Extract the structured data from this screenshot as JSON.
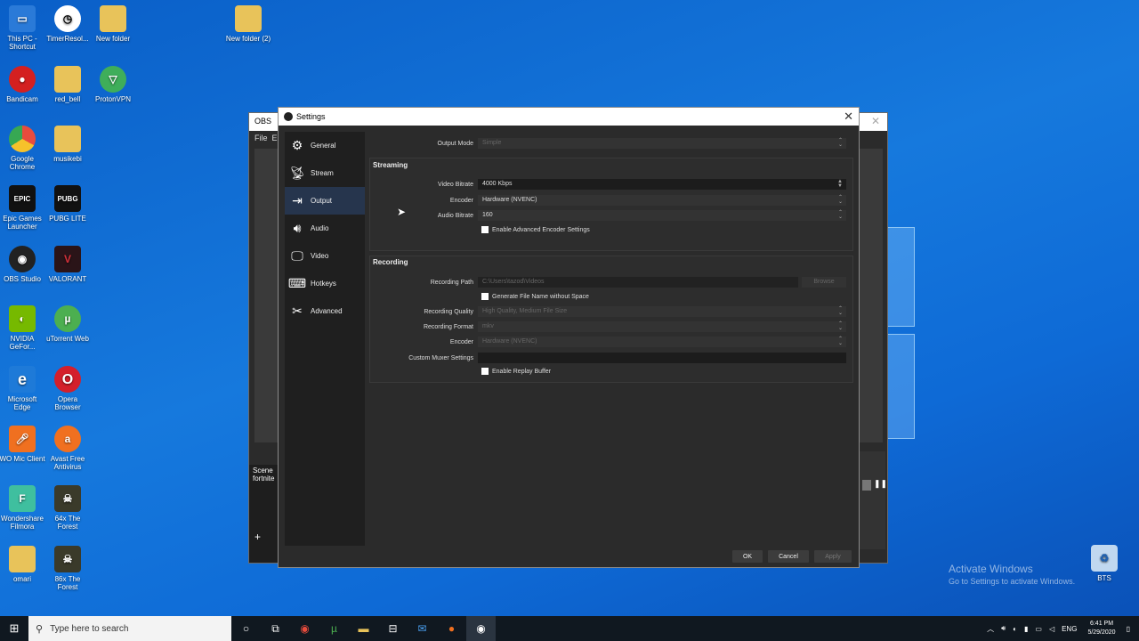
{
  "desktop": {
    "icons": [
      {
        "label": "This PC - Shortcut",
        "color": "#2a7ad8"
      },
      {
        "label": "TimerResol...",
        "color": "#ffffff"
      },
      {
        "label": "New folder",
        "color": "#e8c35a"
      },
      {
        "label": "New folder (2)",
        "color": "#e8c35a"
      },
      {
        "label": "Bandicam",
        "color": "#d42020"
      },
      {
        "label": "red_bell",
        "color": "#e8c35a"
      },
      {
        "label": "ProtonVPN",
        "color": "#3fae5a"
      },
      {
        "label": "Google Chrome",
        "color": "#e84c3d"
      },
      {
        "label": "musikebi",
        "color": "#e8c35a"
      },
      {
        "label": "Epic Games Launcher",
        "color": "#111111"
      },
      {
        "label": "PUBG LITE",
        "color": "#111111"
      },
      {
        "label": "OBS Studio",
        "color": "#222222"
      },
      {
        "label": "VALORANT",
        "color": "#d4303a"
      },
      {
        "label": "NVIDIA GeFor...",
        "color": "#76b900"
      },
      {
        "label": "uTorrent Web",
        "color": "#4caf50"
      },
      {
        "label": "Microsoft Edge",
        "color": "#1e7ad8"
      },
      {
        "label": "Opera Browser",
        "color": "#d41f2b"
      },
      {
        "label": "WO Mic Client",
        "color": "#f07020"
      },
      {
        "label": "Avast Free Antivirus",
        "color": "#f07020"
      },
      {
        "label": "Wondershare Filmora",
        "color": "#3fbf9f"
      },
      {
        "label": "64x The Forest",
        "color": "#3a3a2a"
      },
      {
        "label": "omari",
        "color": "#e8c35a"
      },
      {
        "label": "86x The Forest",
        "color": "#3a3a2a"
      },
      {
        "label": "BTS",
        "color": "#c0d8f0"
      }
    ]
  },
  "obs_main": {
    "title": "OBS",
    "menu_file": "File",
    "menu_edit": "E",
    "scenes_header": "Scene",
    "scene_item": "fortnite"
  },
  "settings": {
    "title": "Settings",
    "sidebar": [
      {
        "label": "General",
        "icon": "gear-icon"
      },
      {
        "label": "Stream",
        "icon": "antenna-icon"
      },
      {
        "label": "Output",
        "icon": "output-icon"
      },
      {
        "label": "Audio",
        "icon": "speaker-icon"
      },
      {
        "label": "Video",
        "icon": "monitor-icon"
      },
      {
        "label": "Hotkeys",
        "icon": "keyboard-icon"
      },
      {
        "label": "Advanced",
        "icon": "tools-icon"
      }
    ],
    "active_item": "Output",
    "output_mode_label": "Output Mode",
    "output_mode_value": "Simple",
    "streaming": {
      "title": "Streaming",
      "video_bitrate_label": "Video Bitrate",
      "video_bitrate_value": "4000 Kbps",
      "encoder_label": "Encoder",
      "encoder_value": "Hardware (NVENC)",
      "audio_bitrate_label": "Audio Bitrate",
      "audio_bitrate_value": "160",
      "advanced_encoder_label": "Enable Advanced Encoder Settings"
    },
    "recording": {
      "title": "Recording",
      "path_label": "Recording Path",
      "path_value": "C:\\Users\\tazod\\Videos",
      "browse_label": "Browse",
      "no_space_label": "Generate File Name without Space",
      "quality_label": "Recording Quality",
      "quality_value": "High Quality, Medium File Size",
      "format_label": "Recording Format",
      "format_value": "mkv",
      "encoder_label": "Encoder",
      "encoder_value": "Hardware (NVENC)",
      "muxer_label": "Custom Muxer Settings",
      "muxer_value": "",
      "replay_label": "Enable Replay Buffer"
    },
    "buttons": {
      "ok": "OK",
      "cancel": "Cancel",
      "apply": "Apply"
    }
  },
  "watermark": {
    "line1": "Activate Windows",
    "line2": "Go to Settings to activate Windows."
  },
  "taskbar": {
    "search_placeholder": "Type here to search",
    "language": "ENG",
    "time": "6:41 PM",
    "date": "5/29/2020"
  }
}
